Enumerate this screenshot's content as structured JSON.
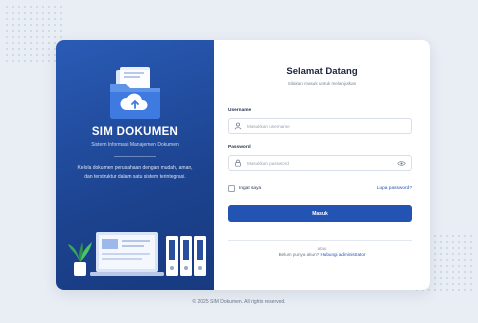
{
  "brand": {
    "title": "SIM DOKUMEN",
    "subtitle": "Sistem Informasi Manajemen Dokumen",
    "description": "Kelola dokumen perusahaan dengan mudah, aman, dan terstruktur dalam satu sistem terintegrasi.",
    "accent_color": "#2354b3"
  },
  "login": {
    "title": "Selamat Datang",
    "subtitle": "Silakan masuk untuk melanjutkan",
    "username_label": "Username",
    "username_placeholder": "Masukkan username",
    "password_label": "Password",
    "password_placeholder": "Masukkan password",
    "remember_label": "Ingat saya",
    "forgot_label": "Lupa password?",
    "submit_label": "Masuk",
    "divider_text": "atau",
    "register_prompt": "Belum punya akun?",
    "register_link": "Hubungi administrator"
  },
  "footer": {
    "text": "© 2025 SIM Dokumen. All rights reserved."
  }
}
